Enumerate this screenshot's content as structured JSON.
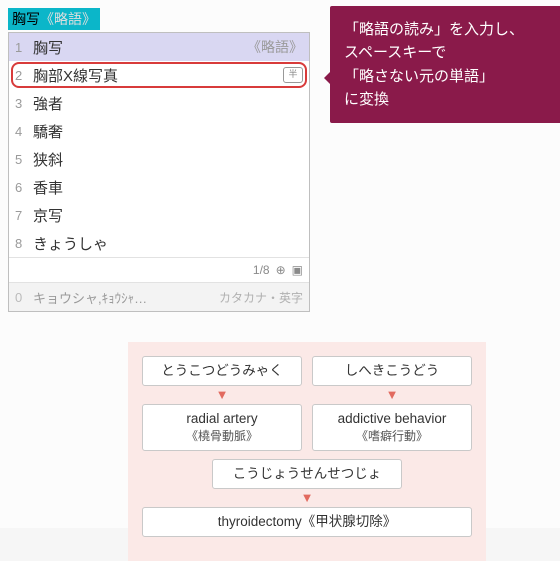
{
  "ime": {
    "input_main": "胸写",
    "input_tag": "《略語》",
    "rows": [
      {
        "n": "1",
        "word": "胸写",
        "tag": "《略語》",
        "sel": true,
        "outlined": false,
        "badge": false
      },
      {
        "n": "2",
        "word": "胸部X線写真",
        "tag": "",
        "sel": false,
        "outlined": true,
        "badge": true
      },
      {
        "n": "3",
        "word": "強者",
        "tag": "",
        "sel": false,
        "outlined": false,
        "badge": false
      },
      {
        "n": "4",
        "word": "驕奢",
        "tag": "",
        "sel": false,
        "outlined": false,
        "badge": false
      },
      {
        "n": "5",
        "word": "狭斜",
        "tag": "",
        "sel": false,
        "outlined": false,
        "badge": false
      },
      {
        "n": "6",
        "word": "香車",
        "tag": "",
        "sel": false,
        "outlined": false,
        "badge": false
      },
      {
        "n": "7",
        "word": "京写",
        "tag": "",
        "sel": false,
        "outlined": false,
        "badge": false
      },
      {
        "n": "8",
        "word": "きょうしゃ",
        "tag": "",
        "sel": false,
        "outlined": false,
        "badge": false
      }
    ],
    "badge_label": "半",
    "page": "1/8",
    "sub_n": "0",
    "sub_word": "キョウシャ,ｷｮｳｼｬ…",
    "sub_tag": "カタカナ・英字"
  },
  "callout": {
    "line1": "「略語の読み」を入力し、",
    "line2": "スペースキーで",
    "line3": "「略さない元の単語」",
    "line4": "に変換"
  },
  "examples": {
    "pair1_in": "とうこつどうみゃく",
    "pair1_out": "radial artery",
    "pair1_sub": "《橈骨動脈》",
    "pair2_in": "しへきこうどう",
    "pair2_out": "addictive behavior",
    "pair2_sub": "《嗜癖行動》",
    "pair3_in": "こうじょうせんせつじょ",
    "pair3_out": "thyroidectomy《甲状腺切除》",
    "arrow": "▼"
  }
}
